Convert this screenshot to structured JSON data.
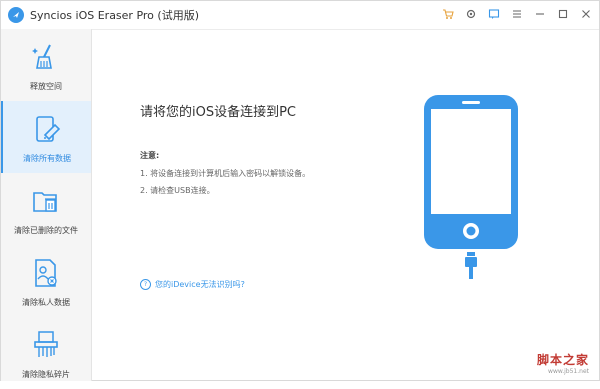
{
  "app": {
    "title": "Syncios iOS Eraser Pro (试用版)",
    "accent_color": "#3a97e8",
    "titlebar_icons": [
      "cart-icon",
      "gear-icon",
      "feedback-icon",
      "menu-icon",
      "minimize-icon",
      "maximize-icon",
      "close-icon"
    ]
  },
  "sidebar": {
    "items": [
      {
        "label": "释放空间",
        "icon": "broom-icon",
        "active": false
      },
      {
        "label": "清除所有数据",
        "icon": "phone-eraser-icon",
        "active": true
      },
      {
        "label": "清除已删除的文件",
        "icon": "folder-trash-icon",
        "active": false
      },
      {
        "label": "清除私人数据",
        "icon": "private-doc-icon",
        "active": false
      },
      {
        "label": "清除隐私碎片",
        "icon": "shredder-icon",
        "active": false
      }
    ]
  },
  "main": {
    "headline": "请将您的iOS设备连接到PC",
    "note_title": "注意:",
    "notes": [
      "1. 将设备连接到计算机后输入密码以解锁设备。",
      "2. 请检查USB连接。"
    ],
    "help_link": "您的iDevice无法识别吗?"
  },
  "watermark": {
    "main": "脚本之家",
    "sub": "www.jb51.net"
  }
}
